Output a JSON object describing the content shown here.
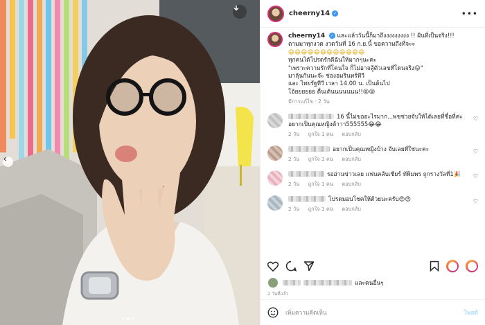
{
  "post": {
    "username": "cheerny14",
    "more_icon": "more-horizontal-icon"
  },
  "caption": {
    "username": "cheerny14",
    "lines": [
      "และแล้ววันนี้ก็มาถึงงงงงงงงง !! ฝันที่เป็นจริง!!!",
      "ตามมาทุกงวด งวดวันที่ 16 ก.ย.นี้ ขอความถึงที่จะะ",
      "😄😄😄😄😄😄😄😄😄😄😄😄",
      "ทุกคนได้โปรดรักดีฉันให้มากๆนะคะ",
      "\"เพราะความรักที่โคนใจ ก็ไม่อาจสู้ตัวเลขที่โดนจริง😛\"",
      "มาลุ้นกันนะจ๊ะ ช่องอมรินทร์ทีวี",
      "และ ไทยรัฐทีวี เวลา 14.00 น. เป็นต้นไป",
      "โอ้ยยยยยย ตื่นเต้นนนนนนน!!😝😝"
    ],
    "meta": "มีการแก้ไข · 2 วัน"
  },
  "comments": [
    {
      "text": "16 นี้ไม่ขออะไรมาก...พชช่วยจับให้ได้เลยที่ชื่อที่ค่ะ อยากเป็นคุณหญิงต้าาา555555😂😂",
      "time": "2 วัน",
      "likes": "ถูกใจ 1 คน",
      "reply": "ตอบกลับ"
    },
    {
      "text": "อยากเป็นคุณหญิงบ้าง จับเลยที่ใช่นะคะ",
      "time": "2 วัน",
      "likes": "ถูกใจ 1 คน",
      "reply": "ตอบกลับ"
    },
    {
      "text": "รออ่านข่าวเลย แฟนคลับเชียร์ ทัพิมพร ถูกรางวัลที่1🎉",
      "time": "2 วัน",
      "likes": "ถูกใจ 1 คน",
      "reply": "ตอบกลับ"
    },
    {
      "text": "โปรดมอบโชคให้ด้วยนะครับ😍😍",
      "time": "2 วัน",
      "likes": "ถูกใจ 1 คน",
      "reply": "ตอบกลับ"
    }
  ],
  "likes_text": "และคนอื่นๆ",
  "post_time": "2 วันที่แล้ว",
  "add_comment": {
    "placeholder": "เพิ่มความคิดเห็น",
    "post_label": "โพสต์"
  },
  "colors": {
    "verified": "#3897f0",
    "avatar_ring": "#d92e7f",
    "link_muted": "#8e8e8e"
  }
}
